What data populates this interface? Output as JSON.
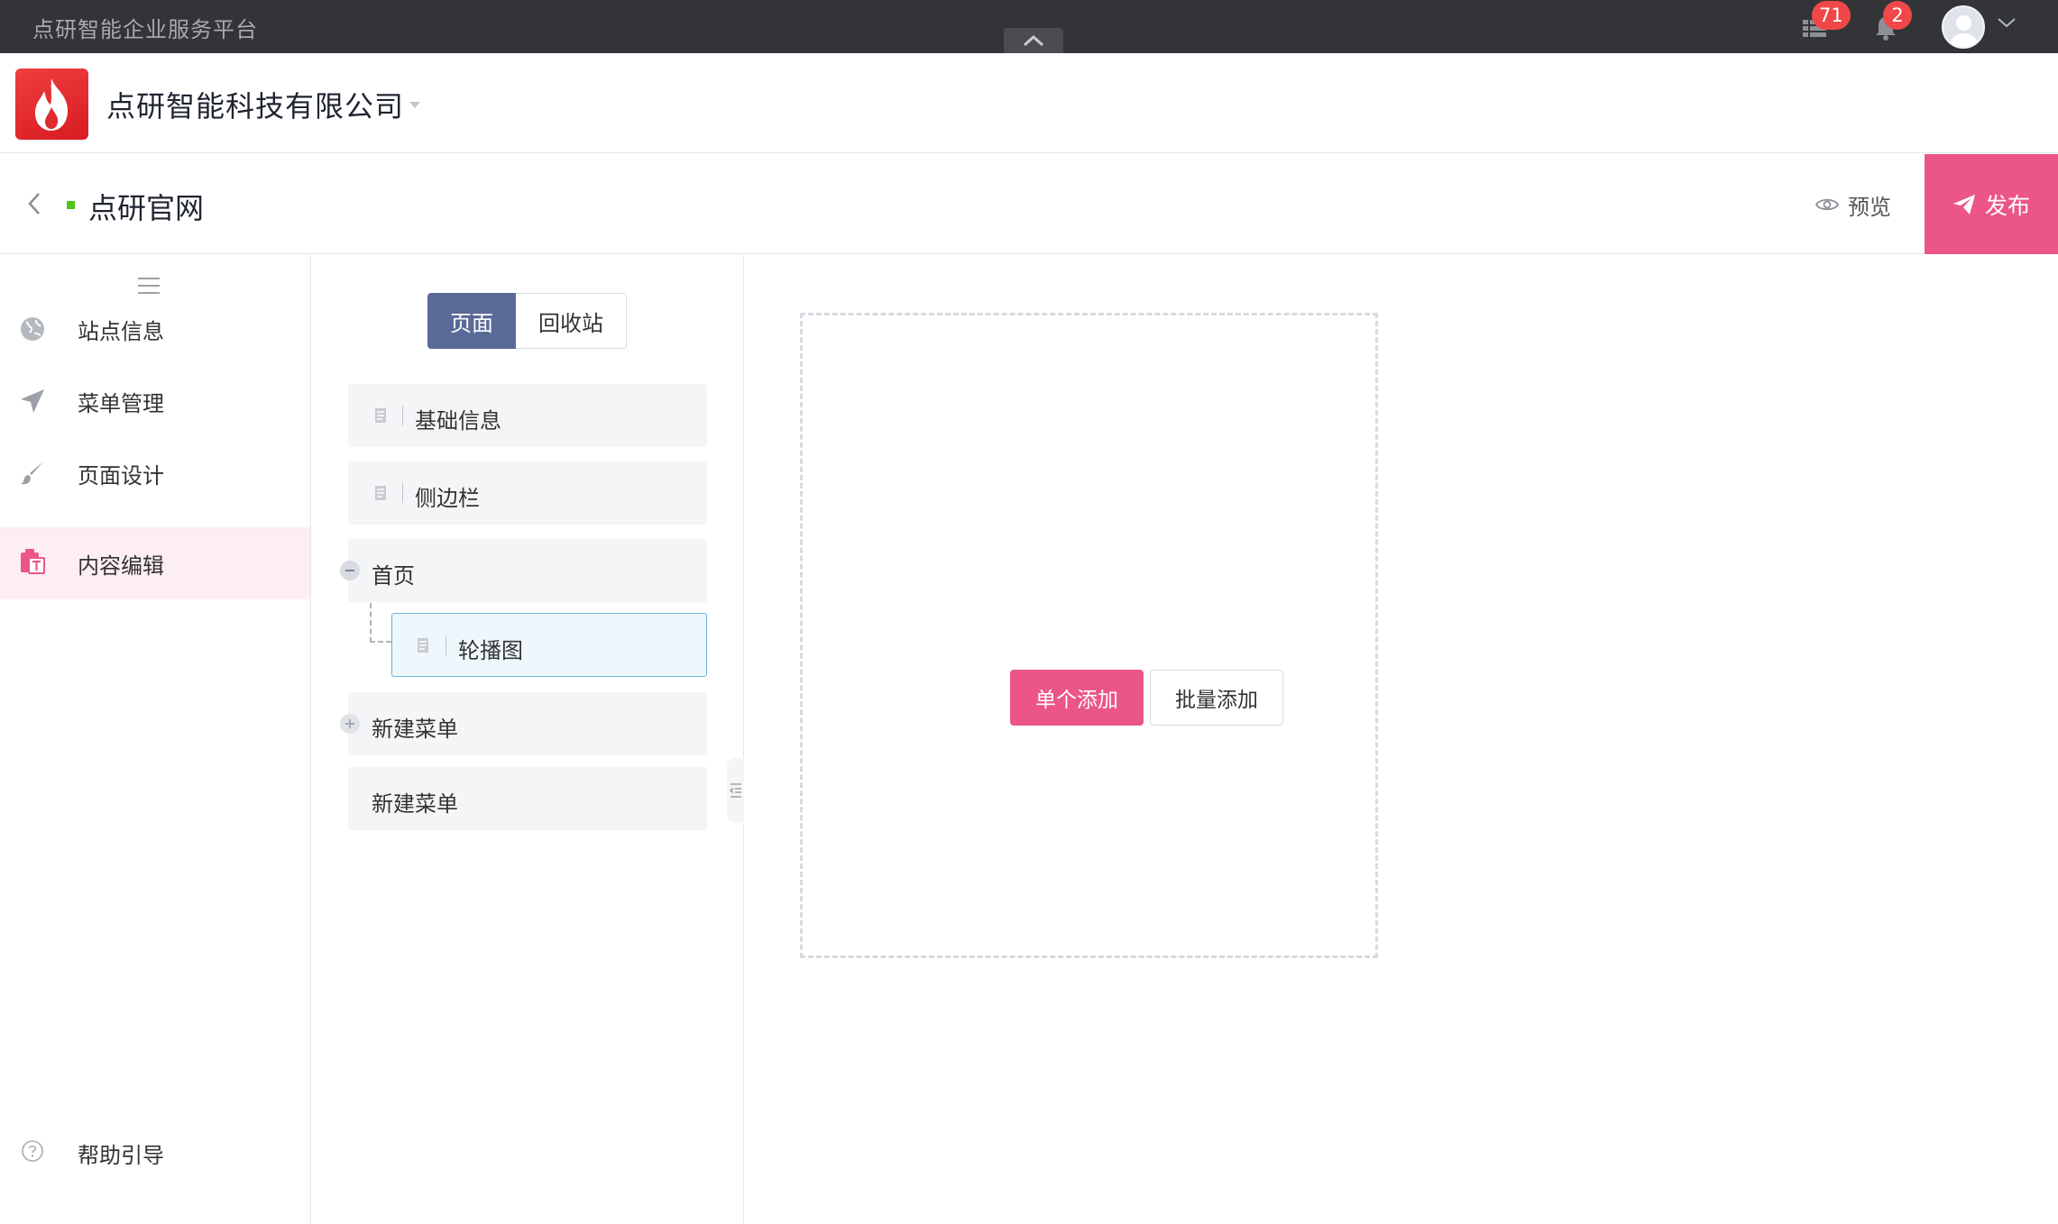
{
  "topbar": {
    "platform_name": "点研智能企业服务平台",
    "apps_badge": "71",
    "notifications_badge": "2"
  },
  "company": {
    "name": "点研智能科技有限公司"
  },
  "site": {
    "name": "点研官网",
    "preview_label": "预览",
    "publish_label": "发布",
    "status_color": "#52c41a"
  },
  "sidebar": {
    "items": [
      {
        "label": "站点信息",
        "icon": "globe-icon"
      },
      {
        "label": "菜单管理",
        "icon": "send-icon"
      },
      {
        "label": "页面设计",
        "icon": "brush-icon"
      },
      {
        "label": "内容编辑",
        "icon": "content-edit-icon",
        "active": true
      }
    ],
    "help_label": "帮助引导"
  },
  "tree": {
    "tabs": [
      {
        "label": "页面",
        "active": true
      },
      {
        "label": "回收站",
        "active": false
      }
    ],
    "nodes": [
      {
        "label": "基础信息"
      },
      {
        "label": "侧边栏"
      },
      {
        "label": "首页",
        "expanded": true,
        "children": [
          {
            "label": "轮播图",
            "selected": true
          }
        ]
      },
      {
        "label": "新建菜单",
        "expandable": true
      },
      {
        "label": "新建菜单"
      }
    ]
  },
  "canvas": {
    "add_single_label": "单个添加",
    "add_batch_label": "批量添加"
  },
  "colors": {
    "accent": "#eb5686",
    "topbar": "#323437",
    "tab_active": "#5a6a96",
    "badge": "#f04848"
  }
}
